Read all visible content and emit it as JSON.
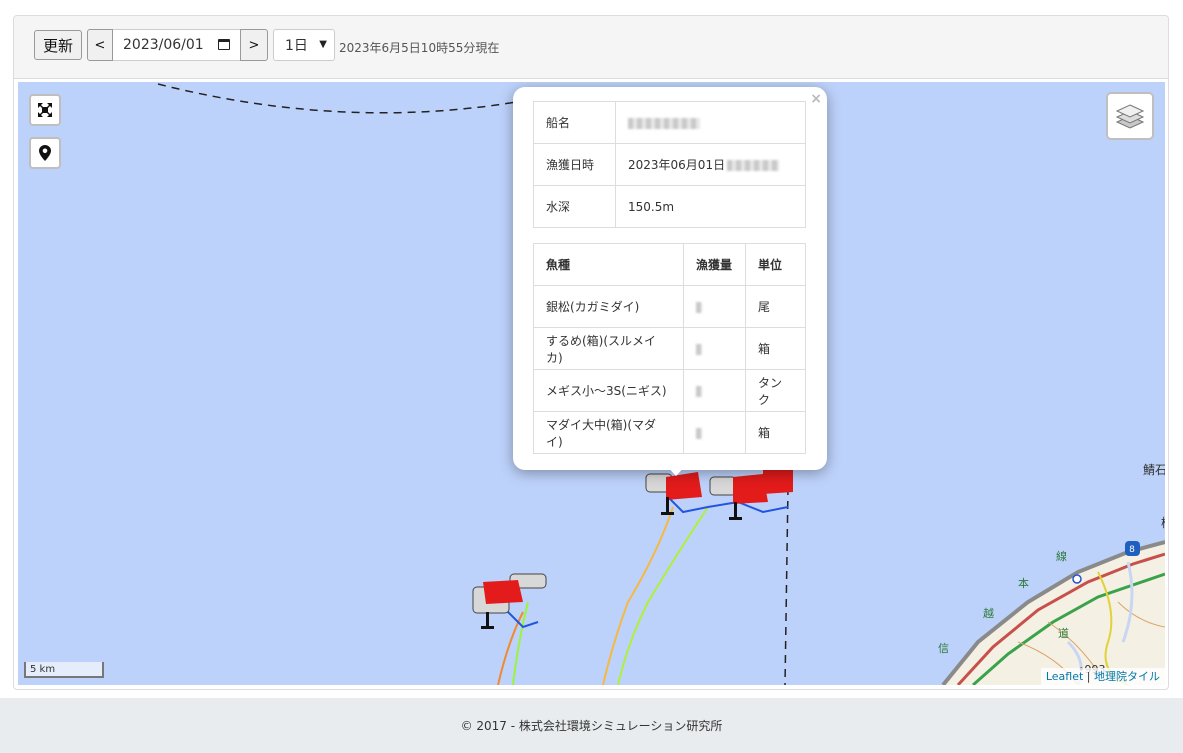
{
  "toolbar": {
    "update_label": "更新",
    "prev_label": "<",
    "next_label": ">",
    "date_value": "2023/06/01",
    "period_value": "1日",
    "status": "2023年6月5日10時55分現在"
  },
  "map": {
    "scale_label": "5 km",
    "attribution_leaflet": "Leaflet",
    "attribution_sep": " | ",
    "attribution_tiles": "地理院タイル",
    "place_labels": [
      "鯖石",
      "信",
      "越",
      "本",
      "線",
      "道",
      "8",
      "•993"
    ],
    "water_color": "#bdd2fb"
  },
  "popup": {
    "close_label": "×",
    "info": [
      {
        "key": "船名",
        "value": ""
      },
      {
        "key": "漁獲日時",
        "value": "2023年06月01日"
      },
      {
        "key": "水深",
        "value": "150.5m"
      }
    ],
    "catch_headers": [
      "魚種",
      "漁獲量",
      "単位"
    ],
    "catch_rows": [
      {
        "species": "銀松(カガミダイ)",
        "unit": "尾"
      },
      {
        "species": "するめ(箱)(スルメイカ)",
        "unit": "箱"
      },
      {
        "species": "メギス小～3S(ニギス)",
        "unit": "タンク"
      },
      {
        "species": "マダイ大中(箱)(マダイ)",
        "unit": "箱"
      }
    ]
  },
  "footer": {
    "copyright": "© 2017 - 株式会社環境シミュレーション研究所"
  }
}
